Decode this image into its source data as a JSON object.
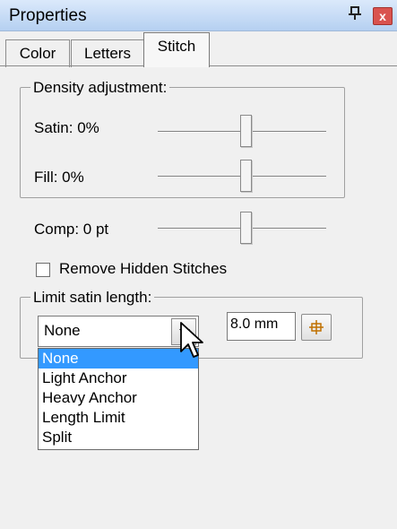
{
  "window": {
    "title": "Properties",
    "pin_icon": "pin-icon",
    "close_icon": "close-icon",
    "close_glyph": "x"
  },
  "tabs": [
    {
      "label": "Color",
      "active": false
    },
    {
      "label": "Letters",
      "active": false
    },
    {
      "label": "Stitch",
      "active": true
    }
  ],
  "density": {
    "legend": "Density adjustment:",
    "satin_label": "Satin: 0%",
    "fill_label": "Fill: 0%"
  },
  "comp": {
    "label": "Comp: 0 pt"
  },
  "remove_hidden": {
    "label": "Remove Hidden Stitches",
    "checked": false
  },
  "limit_satin": {
    "legend": "Limit satin length:",
    "selected": "None",
    "options": [
      "None",
      "Light Anchor",
      "Heavy Anchor",
      "Length Limit",
      "Split"
    ],
    "length_value": "8.0 mm",
    "pick_button_icon": "measure-icon"
  },
  "colors": {
    "title_gradient_top": "#dbe9fb",
    "title_gradient_bottom": "#b5d0f1",
    "selection": "#3399ff",
    "close": "#d9534f"
  }
}
